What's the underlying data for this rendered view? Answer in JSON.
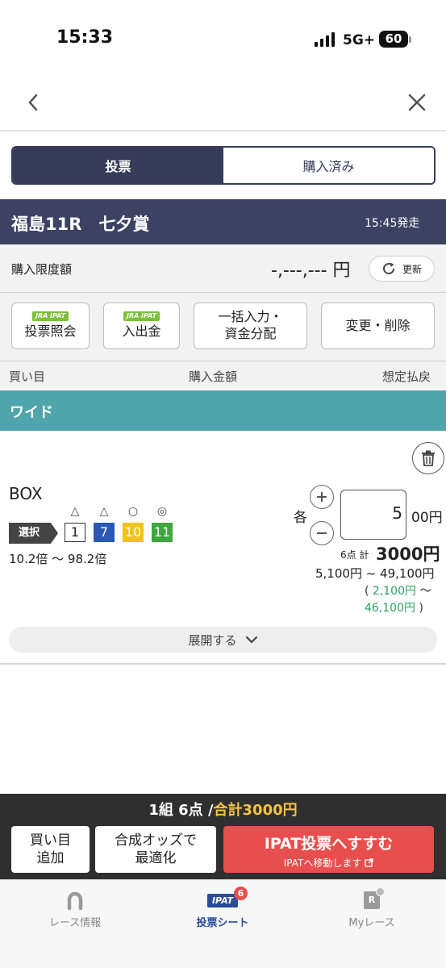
{
  "status_bar": {
    "time": "15:33",
    "network": "5G+",
    "battery": "60"
  },
  "tabs": [
    {
      "label": "投票"
    },
    {
      "label": "購入済み"
    }
  ],
  "race": {
    "name": "福島11R　七夕賞",
    "start_time": "15:45発走"
  },
  "limit": {
    "label": "購入限度額",
    "value": "-,---,--- 円",
    "refresh_label": "更新"
  },
  "actions": {
    "ipat_badge": "JRA IPAT",
    "inquiry_label": "投票照会",
    "deposit_label": "入出金",
    "bulk_line1": "一括入力・",
    "bulk_line2": "資金分配",
    "edit_label": "変更・削除"
  },
  "columns": {
    "selection": "買い目",
    "amount": "購入金額",
    "payout": "想定払戻"
  },
  "bet": {
    "type": "ワイド",
    "method": "BOX",
    "select_label": "選択",
    "horses": [
      {
        "number": "1",
        "mark": "△",
        "bg": "#ffffff",
        "fg": "#222222"
      },
      {
        "number": "7",
        "mark": "△",
        "bg": "#2b57b5",
        "fg": "#ffffff"
      },
      {
        "number": "10",
        "mark": "○",
        "bg": "#f2c318",
        "fg": "#ffffff"
      },
      {
        "number": "11",
        "mark": "◎",
        "bg": "#3fa640",
        "fg": "#ffffff"
      }
    ],
    "odds_range": "10.2倍 〜 98.2倍",
    "each_label": "各",
    "amount_value": "5",
    "amount_unit": "00円",
    "count_label": "6点 計",
    "total": "3000円",
    "payout_range": "5,100円 ~ 49,100円",
    "profit_open": "(",
    "profit_min": "2,100円",
    "profit_tilde": "〜",
    "profit_max": "46,100円",
    "profit_close": ")",
    "expand_label": "展開する"
  },
  "summary": {
    "text": "1組 6点 /",
    "total": "合計3000円",
    "add_line1": "買い目",
    "add_line2": "追加",
    "optimize_line1": "合成オッズで",
    "optimize_line2": "最適化",
    "ipat_main": "IPAT投票へすすむ",
    "ipat_sub": "IPATへ移動します"
  },
  "bottom_nav": {
    "race_info": "レース情報",
    "ipat_logo": "IPAT",
    "badge": "6",
    "vote_sheet": "投票シート",
    "my_race": "Myレース",
    "my_race_icon_letter": "R"
  },
  "colors": {
    "navy": "#353d59",
    "teal": "#4fa5ab",
    "red": "#e84e4e",
    "green": "#2ea061"
  }
}
